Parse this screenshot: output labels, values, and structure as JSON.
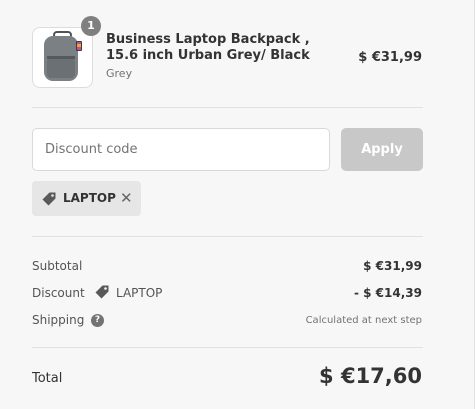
{
  "product": {
    "quantity": "1",
    "name": "Business Laptop Backpack , 15.6 inch Urban Grey/ Black",
    "variant": "Grey",
    "price": "$ €31,99"
  },
  "discount": {
    "placeholder": "Discount code",
    "apply_label": "Apply",
    "applied_code": "LAPTOP",
    "remove_symbol": "✕"
  },
  "summary": {
    "subtotal_label": "Subtotal",
    "subtotal_value": "$ €31,99",
    "discount_label": "Discount",
    "discount_code": "LAPTOP",
    "discount_value": "- $ €14,39",
    "shipping_label": "Shipping",
    "shipping_help": "?",
    "shipping_value": "Calculated at next step",
    "total_label": "Total",
    "total_value": "$ €17,60"
  },
  "icons": {
    "tag": "tag-icon",
    "help": "help-icon",
    "remove": "close-icon",
    "product_image": "backpack-image"
  }
}
